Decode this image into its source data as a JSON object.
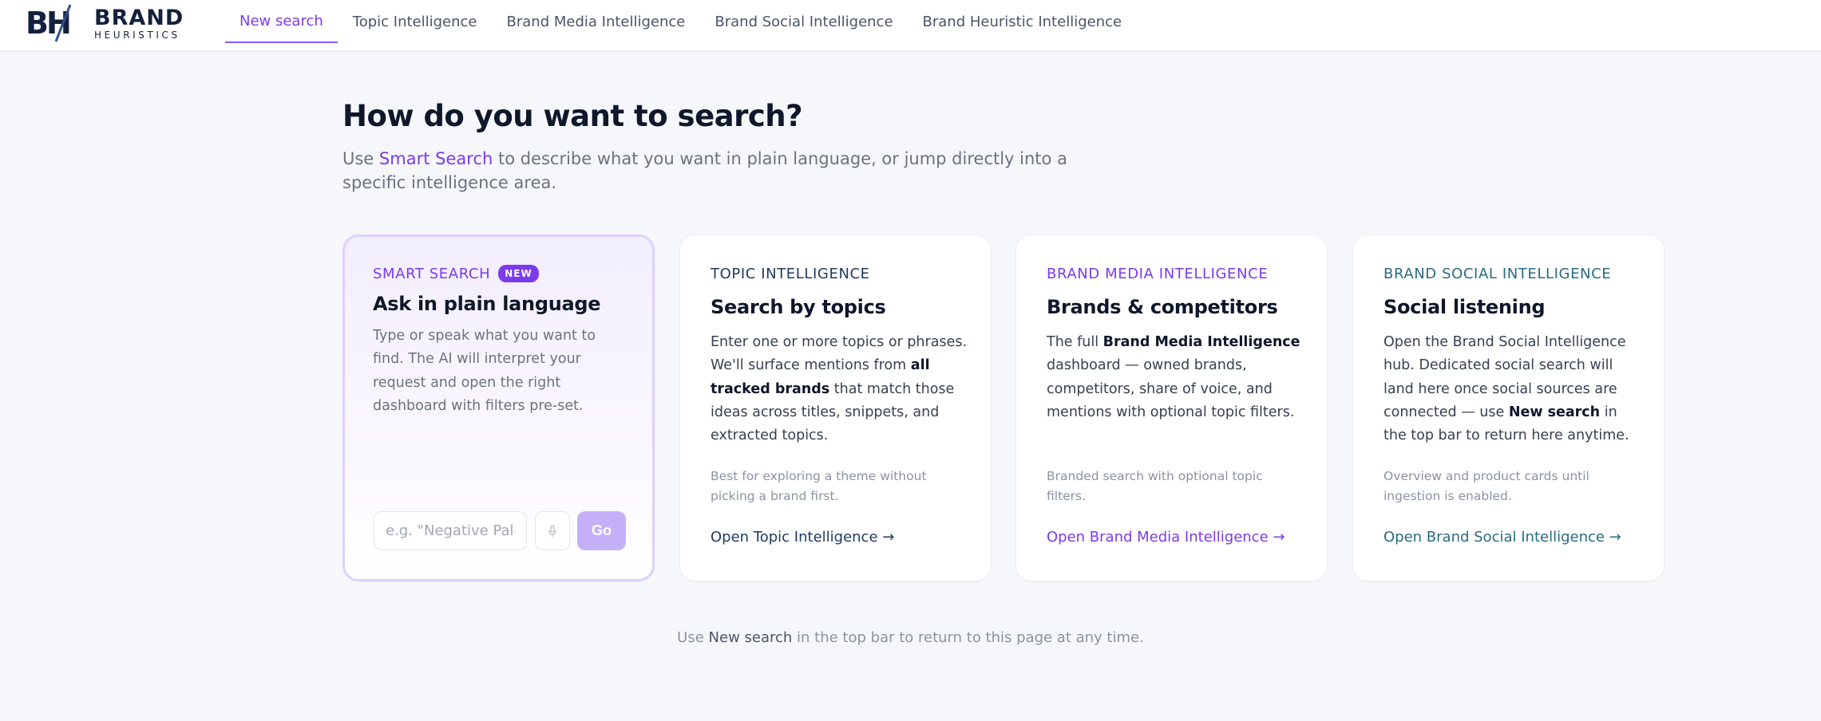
{
  "logo": {
    "brand": "BRAND",
    "sub": "HEURISTICS",
    "mark_text": "BH"
  },
  "nav": [
    {
      "label": "New search",
      "active": true
    },
    {
      "label": "Topic Intelligence"
    },
    {
      "label": "Brand Media Intelligence"
    },
    {
      "label": "Brand Social Intelligence"
    },
    {
      "label": "Brand Heuristic Intelligence"
    }
  ],
  "heading": "How do you want to search?",
  "subhead": {
    "before": "Use ",
    "highlight": "Smart Search",
    "after": " to describe what you want in plain language, or jump directly into a specific intelligence area."
  },
  "cards": {
    "smart": {
      "eyebrow": "SMART SEARCH",
      "badge": "NEW",
      "title": "Ask in plain language",
      "body": "Type or speak what you want to find. The AI will interpret your request and open the right dashboard with filters pre-set.",
      "input_placeholder": "e.g. \"Negative Palo",
      "mic_icon": "microphone-icon",
      "go_label": "Go",
      "color": "#7c3aed"
    },
    "topic": {
      "eyebrow": "TOPIC INTELLIGENCE",
      "title": "Search by topics",
      "body_1": "Enter one or more topics or phrases. We'll surface mentions from ",
      "body_bold": "all tracked brands",
      "body_2": " that match those ideas across titles, snippets, and extracted topics.",
      "note": "Best for exploring a theme without picking a brand first.",
      "link": "Open Topic Intelligence →",
      "color": "#1e3a5f"
    },
    "media": {
      "eyebrow": "BRAND MEDIA INTELLIGENCE",
      "title": "Brands & competitors",
      "body_1": "The full ",
      "body_bold": "Brand Media Intelligence",
      "body_2": " dashboard — owned brands, competitors, share of voice, and mentions with optional topic filters.",
      "note": "Branded search with optional topic filters.",
      "link": "Open Brand Media Intelligence →",
      "color": "#7c3aed"
    },
    "social": {
      "eyebrow": "BRAND SOCIAL INTELLIGENCE",
      "title": "Social listening",
      "body_1": "Open the Brand Social Intelligence hub. Dedicated social search will land here once social sources are connected — use ",
      "body_bold": "New search",
      "body_2": " in the top bar to return here anytime.",
      "note": "Overview and product cards until ingestion is enabled.",
      "link": "Open Brand Social Intelligence →",
      "color": "#2a6b82"
    }
  },
  "footer": {
    "before": "Use ",
    "highlight": "New search",
    "after": " in the top bar to return to this page at any time."
  }
}
